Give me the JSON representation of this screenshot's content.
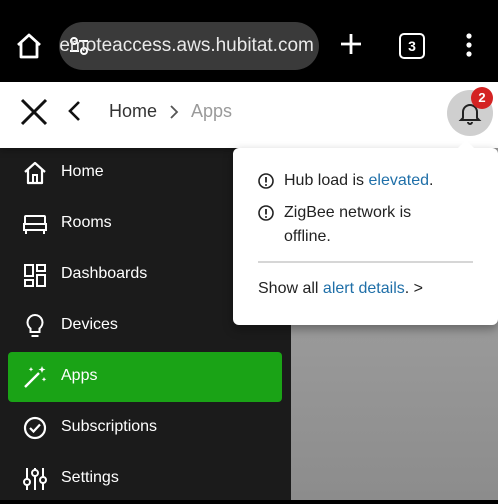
{
  "browser": {
    "url": "remoteaccess.aws.hubitat.com",
    "tab_count": "3"
  },
  "header": {
    "breadcrumb": [
      "Home",
      "Apps"
    ],
    "notification_count": "2"
  },
  "sidebar": {
    "items": [
      {
        "label": "Home",
        "icon": "home-icon",
        "active": false
      },
      {
        "label": "Rooms",
        "icon": "bed-icon",
        "active": false
      },
      {
        "label": "Dashboards",
        "icon": "dashboard-icon",
        "active": false
      },
      {
        "label": "Devices",
        "icon": "lightbulb-icon",
        "active": false
      },
      {
        "label": "Apps",
        "icon": "magic-wand-icon",
        "active": true
      },
      {
        "label": "Subscriptions",
        "icon": "check-circle-icon",
        "active": false
      },
      {
        "label": "Settings",
        "icon": "sliders-icon",
        "active": false
      }
    ]
  },
  "alerts": {
    "items": [
      {
        "text": "Hub load is ",
        "link": "elevated",
        "suffix": "."
      },
      {
        "text": "ZigBee network is offline.",
        "link": "",
        "suffix": ""
      }
    ],
    "show_all_prefix": "Show all ",
    "show_all_link": "alert details",
    "show_all_suffix": ". >"
  },
  "colors": {
    "active_nav": "#1aa316",
    "link": "#1f6fa8",
    "badge": "#d42323",
    "sidebar_bg": "#1b1b1b"
  }
}
